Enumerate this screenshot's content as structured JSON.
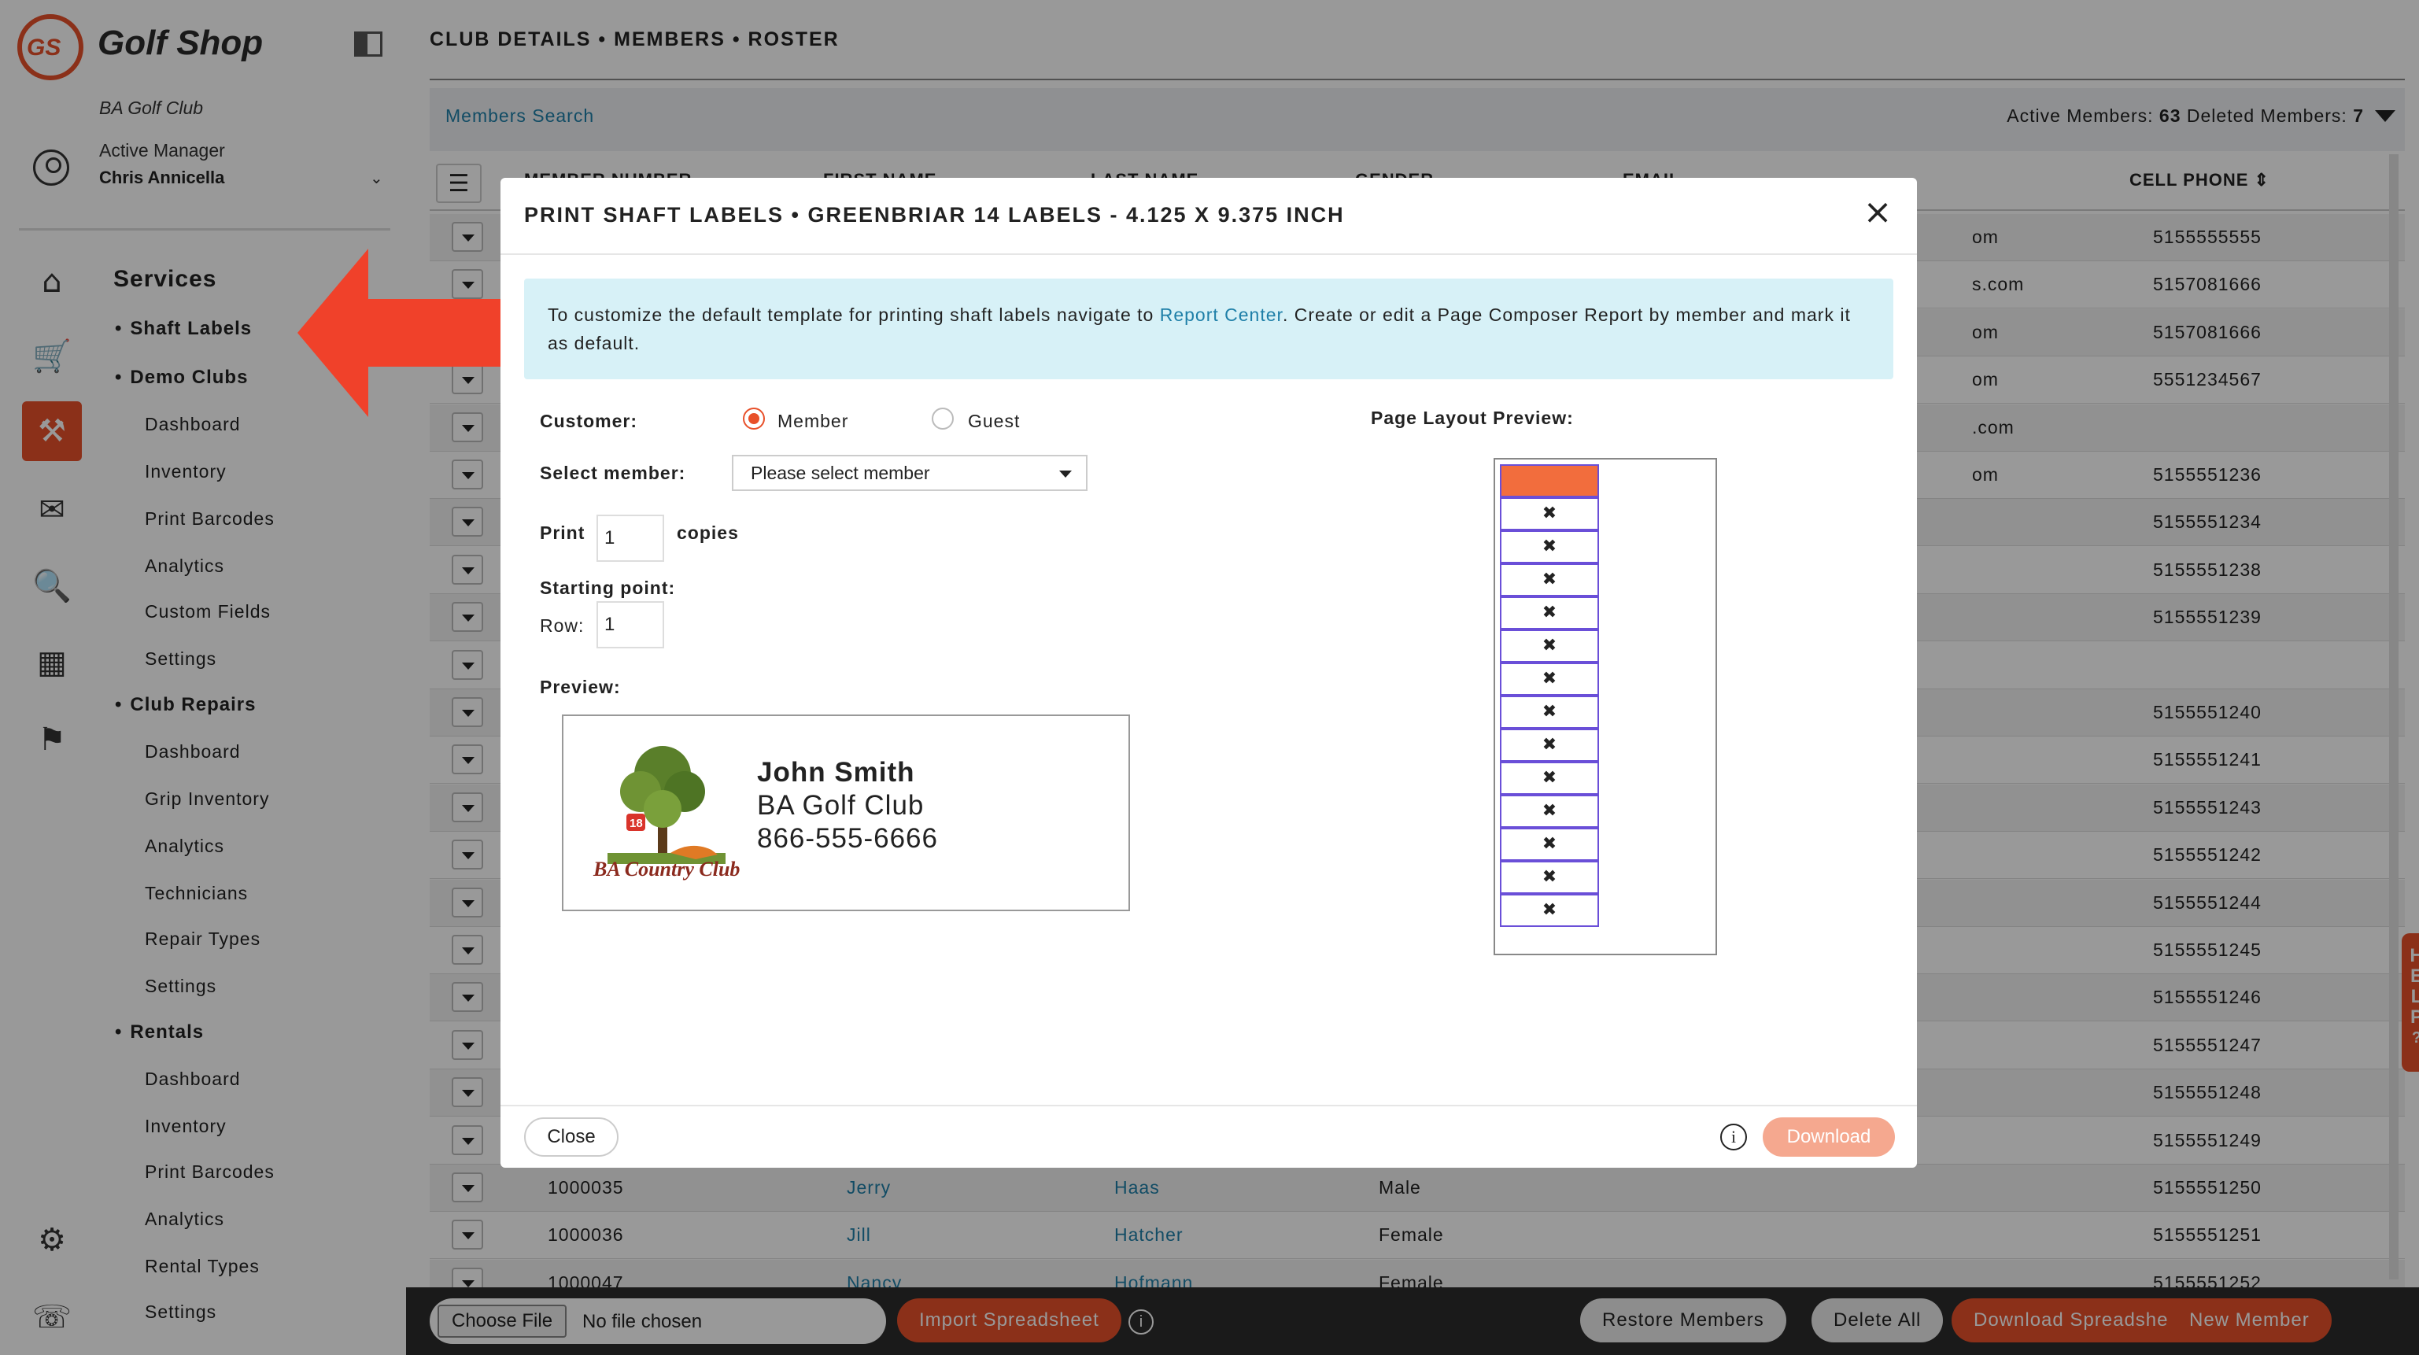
{
  "app": {
    "logo_initials": "GS",
    "title": "Golf Shop",
    "club": "BA Golf Club"
  },
  "user": {
    "role": "Active Manager",
    "name": "Chris Annicella"
  },
  "nav": {
    "title": "Services",
    "groups": [
      {
        "label": "Shaft Labels",
        "items": []
      },
      {
        "label": "Demo Clubs",
        "items": [
          "Dashboard",
          "Inventory",
          "Print Barcodes",
          "Analytics",
          "Custom Fields",
          "Settings"
        ]
      },
      {
        "label": "Club Repairs",
        "items": [
          "Dashboard",
          "Grip Inventory",
          "Analytics",
          "Technicians",
          "Repair Types",
          "Settings"
        ]
      },
      {
        "label": "Rentals",
        "items": [
          "Dashboard",
          "Inventory",
          "Print Barcodes",
          "Analytics",
          "Rental Types",
          "Settings"
        ]
      }
    ]
  },
  "main": {
    "breadcrumb": "CLUB DETAILS • MEMBERS • ROSTER",
    "members_search": "Members Search",
    "stats": {
      "active_label": "Active Members:",
      "active": "63",
      "deleted_label": "Deleted Members:",
      "deleted": "7"
    },
    "headers": {
      "member_number": "MEMBER NUMBER",
      "first_name": "FIRST NAME",
      "last_name": "LAST NAME",
      "gender": "GENDER",
      "email": "EMAIL",
      "cell_phone": "CELL PHONE"
    },
    "rows": [
      {
        "num": "",
        "first": "",
        "last": "",
        "gender": "",
        "email": "om",
        "phone": "5155555555"
      },
      {
        "num": "",
        "first": "",
        "last": "",
        "gender": "",
        "email": "s.com",
        "phone": "5157081666"
      },
      {
        "num": "",
        "first": "",
        "last": "",
        "gender": "",
        "email": "om",
        "phone": "5157081666"
      },
      {
        "num": "",
        "first": "",
        "last": "",
        "gender": "",
        "email": "om",
        "phone": "5551234567"
      },
      {
        "num": "",
        "first": "",
        "last": "",
        "gender": "",
        "email": ".com",
        "phone": ""
      },
      {
        "num": "",
        "first": "",
        "last": "",
        "gender": "",
        "email": "om",
        "phone": "5155551236"
      },
      {
        "num": "",
        "first": "",
        "last": "",
        "gender": "",
        "email": "",
        "phone": "5155551234"
      },
      {
        "num": "",
        "first": "",
        "last": "",
        "gender": "",
        "email": "",
        "phone": "5155551238"
      },
      {
        "num": "",
        "first": "",
        "last": "",
        "gender": "",
        "email": "",
        "phone": "5155551239"
      },
      {
        "num": "",
        "first": "",
        "last": "",
        "gender": "",
        "email": "",
        "phone": ""
      },
      {
        "num": "",
        "first": "",
        "last": "",
        "gender": "",
        "email": "",
        "phone": "5155551240"
      },
      {
        "num": "",
        "first": "",
        "last": "",
        "gender": "",
        "email": "",
        "phone": "5155551241"
      },
      {
        "num": "",
        "first": "",
        "last": "",
        "gender": "",
        "email": "",
        "phone": "5155551243"
      },
      {
        "num": "",
        "first": "",
        "last": "",
        "gender": "",
        "email": "",
        "phone": "5155551242"
      },
      {
        "num": "",
        "first": "",
        "last": "",
        "gender": "",
        "email": "",
        "phone": "5155551244"
      },
      {
        "num": "",
        "first": "",
        "last": "",
        "gender": "",
        "email": "",
        "phone": "5155551245"
      },
      {
        "num": "",
        "first": "",
        "last": "",
        "gender": "",
        "email": "",
        "phone": "5155551246"
      },
      {
        "num": "",
        "first": "",
        "last": "",
        "gender": "",
        "email": "",
        "phone": "5155551247"
      },
      {
        "num": "",
        "first": "",
        "last": "",
        "gender": "",
        "email": "",
        "phone": "5155551248"
      },
      {
        "num": "",
        "first": "",
        "last": "",
        "gender": "",
        "email": "",
        "phone": "5155551249"
      },
      {
        "num": "1000035",
        "first": "Jerry",
        "last": "Haas",
        "gender": "Male",
        "email": "",
        "phone": "5155551250"
      },
      {
        "num": "1000036",
        "first": "Jill",
        "last": "Hatcher",
        "gender": "Female",
        "email": "",
        "phone": "5155551251"
      },
      {
        "num": "1000047",
        "first": "Nancy",
        "last": "Hofmann",
        "gender": "Female",
        "email": "",
        "phone": "5155551252"
      }
    ]
  },
  "bottom": {
    "choose_file": "Choose File",
    "no_file": "No file chosen",
    "import": "Import Spreadsheet",
    "restore": "Restore Members",
    "delete_all": "Delete All",
    "download": "Download Spreadsheet",
    "new_member": "New Member"
  },
  "help_tab": "HELP",
  "modal": {
    "title": "PRINT SHAFT LABELS • GREENBRIAR 14 LABELS - 4.125 X 9.375 INCH",
    "info_pre": "To customize the default template for printing shaft labels navigate to ",
    "info_link": "Report Center",
    "info_post": ". Create or edit a Page Composer Report by member and mark it as default.",
    "customer_label": "Customer:",
    "option_member": "Member",
    "option_guest": "Guest",
    "select_member_label": "Select member:",
    "select_member_placeholder": "Please select member",
    "print_label": "Print",
    "copies_value": "1",
    "copies_label": "copies",
    "starting_point_label": "Starting point:",
    "row_label": "Row:",
    "row_value": "1",
    "preview_label": "Preview:",
    "preview": {
      "name": "John Smith",
      "club": "BA Golf Club",
      "phone": "866-555-6666",
      "logo_text": "BA Country Club",
      "logo_flag": "18"
    },
    "page_layout_label": "Page Layout Preview:",
    "layout_cells": 14,
    "layout_filled_count": 1,
    "close": "Close",
    "download": "Download"
  },
  "colors": {
    "accent": "#e8502a",
    "link": "#1e7fa8",
    "info_bg": "#d7f1f7",
    "layout_border": "#6a4fd8"
  }
}
